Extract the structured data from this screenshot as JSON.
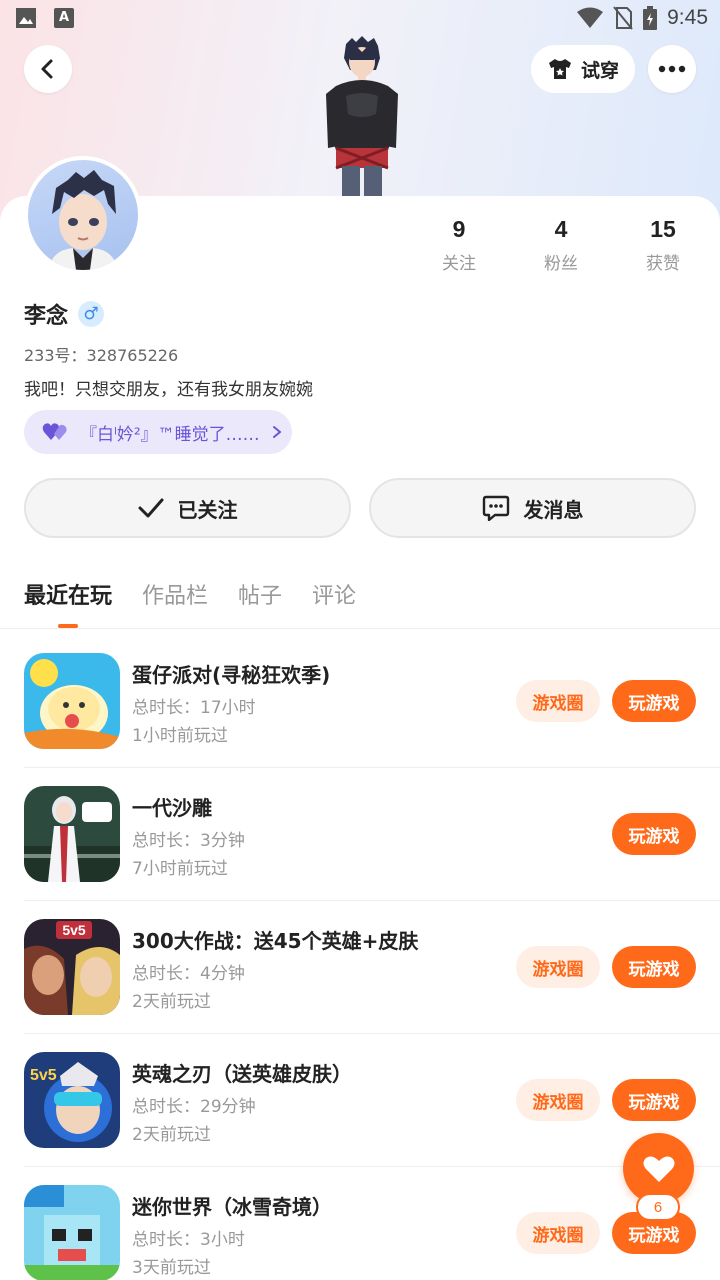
{
  "status_bar": {
    "time": "9:45"
  },
  "header": {
    "try_on_label": "试穿"
  },
  "profile": {
    "name": "李念",
    "gender_symbol": "♂",
    "uid": "233号：328765226",
    "bio": "我吧！只想交朋友，还有我女朋友婉婉",
    "cp_text": "『白ˡ妗²』™睡觉了……",
    "stats": [
      {
        "value": "9",
        "label": "关注"
      },
      {
        "value": "4",
        "label": "粉丝"
      },
      {
        "value": "15",
        "label": "获赞"
      }
    ]
  },
  "actions": {
    "followed_label": "已关注",
    "message_label": "发消息"
  },
  "tabs": [
    {
      "label": "最近在玩",
      "active": true
    },
    {
      "label": "作品栏",
      "active": false
    },
    {
      "label": "帖子",
      "active": false
    },
    {
      "label": "评论",
      "active": false
    }
  ],
  "buttons": {
    "circle_label": "游戏圈",
    "play_label": "玩游戏"
  },
  "games": [
    {
      "title": "蛋仔派对(寻秘狂欢季)",
      "duration": "总时长：17小时",
      "last_played": "1小时前玩过",
      "has_circle": true,
      "icon": "eggy-party-icon"
    },
    {
      "title": "一代沙雕",
      "duration": "总时长：3分钟",
      "last_played": "7小时前玩过",
      "has_circle": false,
      "icon": "yidai-shadiao-icon"
    },
    {
      "title": "300大作战：送45个英雄+皮肤",
      "duration": "总时长：4分钟",
      "last_played": "2天前玩过",
      "has_circle": true,
      "icon": "300-battle-icon"
    },
    {
      "title": "英魂之刃（送英雄皮肤）",
      "duration": "总时长：29分钟",
      "last_played": "2天前玩过",
      "has_circle": true,
      "icon": "yinghun-icon"
    },
    {
      "title": "迷你世界（冰雪奇境）",
      "duration": "总时长：3小时",
      "last_played": "3天前玩过",
      "has_circle": true,
      "icon": "mini-world-icon"
    }
  ],
  "fab": {
    "badge": "6"
  },
  "colors": {
    "accent": "#ff6a1a",
    "accent_light": "#ffeee3",
    "cp_bg": "#ece8fb",
    "cp_text": "#6a55d8"
  }
}
